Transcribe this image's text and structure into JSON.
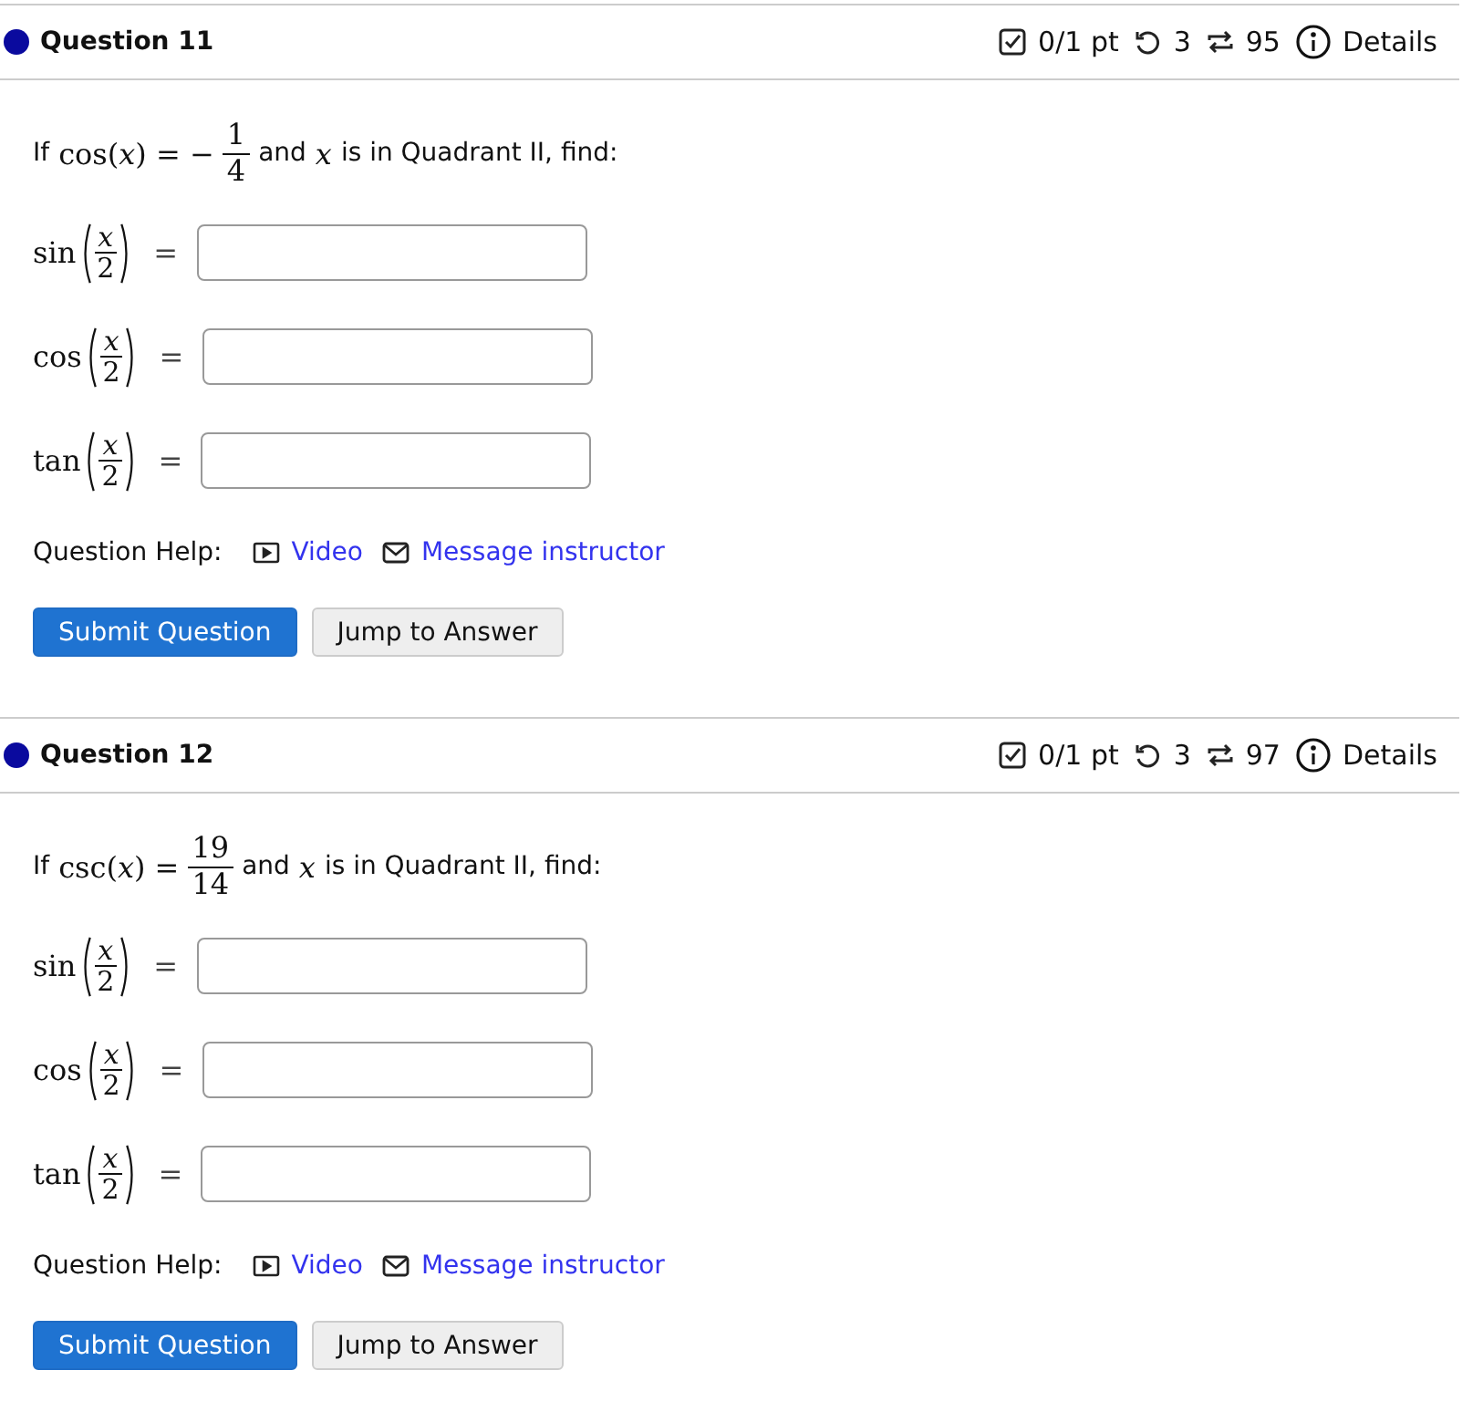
{
  "questions": [
    {
      "title": "Question 11",
      "color": "#0a0a9e",
      "score": "0/1 pt",
      "retries": "3",
      "attempts": "95",
      "details": "Details",
      "prompt": [
        {
          "kind": "text",
          "text": "If"
        },
        {
          "kind": "math",
          "text": "cos(*x*) = −"
        },
        {
          "kind": "frac",
          "num": "1",
          "den": "4"
        },
        {
          "kind": "text",
          "text": "and"
        },
        {
          "kind": "math",
          "text": "*x*"
        },
        {
          "kind": "text",
          "text": "is in Quadrant II, find:"
        }
      ],
      "answers": [
        {
          "func": "sin",
          "num": "x",
          "den": "2",
          "equals": "="
        },
        {
          "func": "cos",
          "num": "x",
          "den": "2",
          "equals": "="
        },
        {
          "func": "tan",
          "num": "x",
          "den": "2",
          "equals": "="
        }
      ],
      "help_label": "Question Help:",
      "links": [
        {
          "kind": "video",
          "label": "Video"
        },
        {
          "kind": "message",
          "label": "Message instructor"
        }
      ],
      "buttons": [
        {
          "kind": "primary",
          "label": "Submit Question"
        },
        {
          "kind": "secondary",
          "label": "Jump to Answer"
        }
      ]
    },
    {
      "title": "Question 12",
      "color": "#0a0a9e",
      "score": "0/1 pt",
      "retries": "3",
      "attempts": "97",
      "details": "Details",
      "prompt": [
        {
          "kind": "text",
          "text": "If"
        },
        {
          "kind": "math",
          "text": "csc(*x*) ="
        },
        {
          "kind": "frac",
          "num": "19",
          "den": "14"
        },
        {
          "kind": "text",
          "text": "and"
        },
        {
          "kind": "math",
          "text": "*x*"
        },
        {
          "kind": "text",
          "text": "is in Quadrant II, find:"
        }
      ],
      "answers": [
        {
          "func": "sin",
          "num": "x",
          "den": "2",
          "equals": "="
        },
        {
          "func": "cos",
          "num": "x",
          "den": "2",
          "equals": "="
        },
        {
          "func": "tan",
          "num": "x",
          "den": "2",
          "equals": "="
        }
      ],
      "help_label": "Question Help:",
      "links": [
        {
          "kind": "video",
          "label": "Video"
        },
        {
          "kind": "message",
          "label": "Message instructor"
        }
      ],
      "buttons": [
        {
          "kind": "primary",
          "label": "Submit Question"
        },
        {
          "kind": "secondary",
          "label": "Jump to Answer"
        }
      ]
    }
  ]
}
